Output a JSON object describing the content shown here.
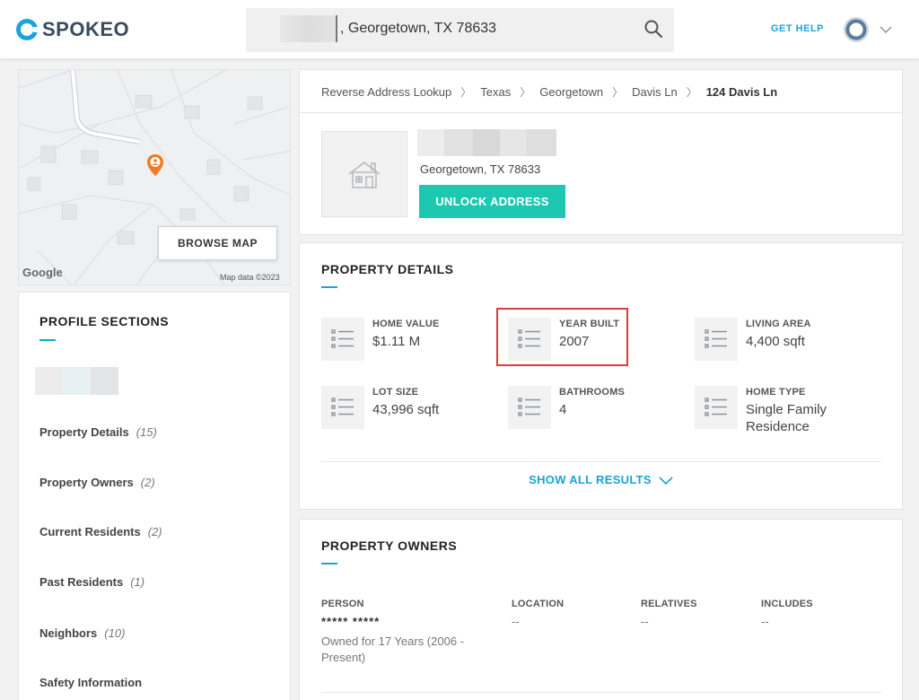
{
  "header": {
    "logo_text": "SPOKEO",
    "search_value": ", Georgetown, TX 78633",
    "get_help": "GET HELP"
  },
  "map": {
    "browse_label": "BROWSE MAP",
    "google": "Google",
    "attribution": "Map data ©2023"
  },
  "sections": {
    "title": "PROFILE SECTIONS",
    "items": [
      {
        "label": "Property Details",
        "count": "(15)"
      },
      {
        "label": "Property Owners",
        "count": "(2)"
      },
      {
        "label": "Current Residents",
        "count": "(2)"
      },
      {
        "label": "Past Residents",
        "count": "(1)"
      },
      {
        "label": "Neighbors",
        "count": "(10)"
      },
      {
        "label": "Safety Information",
        "count": ""
      }
    ]
  },
  "breadcrumb": [
    "Reverse Address Lookup",
    "Texas",
    "Georgetown",
    "Davis Ln",
    "124 Davis Ln"
  ],
  "address": {
    "city": "Georgetown, TX 78633",
    "unlock_label": "UNLOCK ADDRESS"
  },
  "property_details": {
    "title": "PROPERTY DETAILS",
    "items": [
      {
        "label": "HOME VALUE",
        "value": "$1.11 M"
      },
      {
        "label": "YEAR BUILT",
        "value": "2007"
      },
      {
        "label": "LIVING AREA",
        "value": "4,400 sqft"
      },
      {
        "label": "LOT SIZE",
        "value": "43,996 sqft"
      },
      {
        "label": "BATHROOMS",
        "value": "4"
      },
      {
        "label": "HOME TYPE",
        "value": "Single Family Residence"
      }
    ],
    "show_all": "SHOW ALL RESULTS"
  },
  "owners": {
    "title": "PROPERTY OWNERS",
    "columns": [
      "PERSON",
      "LOCATION",
      "RELATIVES",
      "INCLUDES"
    ],
    "row": {
      "person": "***** *****",
      "owned_for": "Owned for 17 Years (2006 - Present)",
      "location": "--",
      "relatives": "--",
      "includes": "--"
    }
  },
  "colors": {
    "accent": "#1aa3dc",
    "unlock": "#1cc8b0",
    "highlight": "#e03b3b",
    "pin": "#f07b22"
  }
}
